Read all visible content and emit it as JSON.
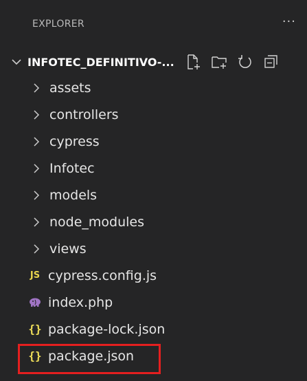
{
  "panel": {
    "title": "EXPLORER",
    "more_label": "···"
  },
  "workspace": {
    "name": "INFOTEC_DEFINITIVO-...",
    "actions": [
      {
        "name": "new-file-icon"
      },
      {
        "name": "new-folder-icon"
      },
      {
        "name": "refresh-icon"
      },
      {
        "name": "collapse-all-icon"
      }
    ]
  },
  "tree": {
    "folders": [
      {
        "label": "assets"
      },
      {
        "label": "controllers"
      },
      {
        "label": "cypress"
      },
      {
        "label": "Infotec"
      },
      {
        "label": "models"
      },
      {
        "label": "node_modules"
      },
      {
        "label": "views"
      }
    ],
    "files": [
      {
        "label": "cypress.config.js",
        "icon": "js-file-icon",
        "icon_text": "JS",
        "color": "#e8d44d"
      },
      {
        "label": "index.php",
        "icon": "php-elephant-icon",
        "color": "#a074c4"
      },
      {
        "label": "package-lock.json",
        "icon": "json-braces-icon",
        "icon_text": "{}",
        "color": "#f1e05a"
      },
      {
        "label": "package.json",
        "icon": "json-braces-icon",
        "icon_text": "{}",
        "color": "#f1e05a"
      }
    ]
  },
  "highlight": {
    "target": "package.json",
    "color": "#e51f1f"
  },
  "colors": {
    "background": "#252526",
    "text": "#e6e6e6",
    "header_text": "#bbbbbb"
  }
}
